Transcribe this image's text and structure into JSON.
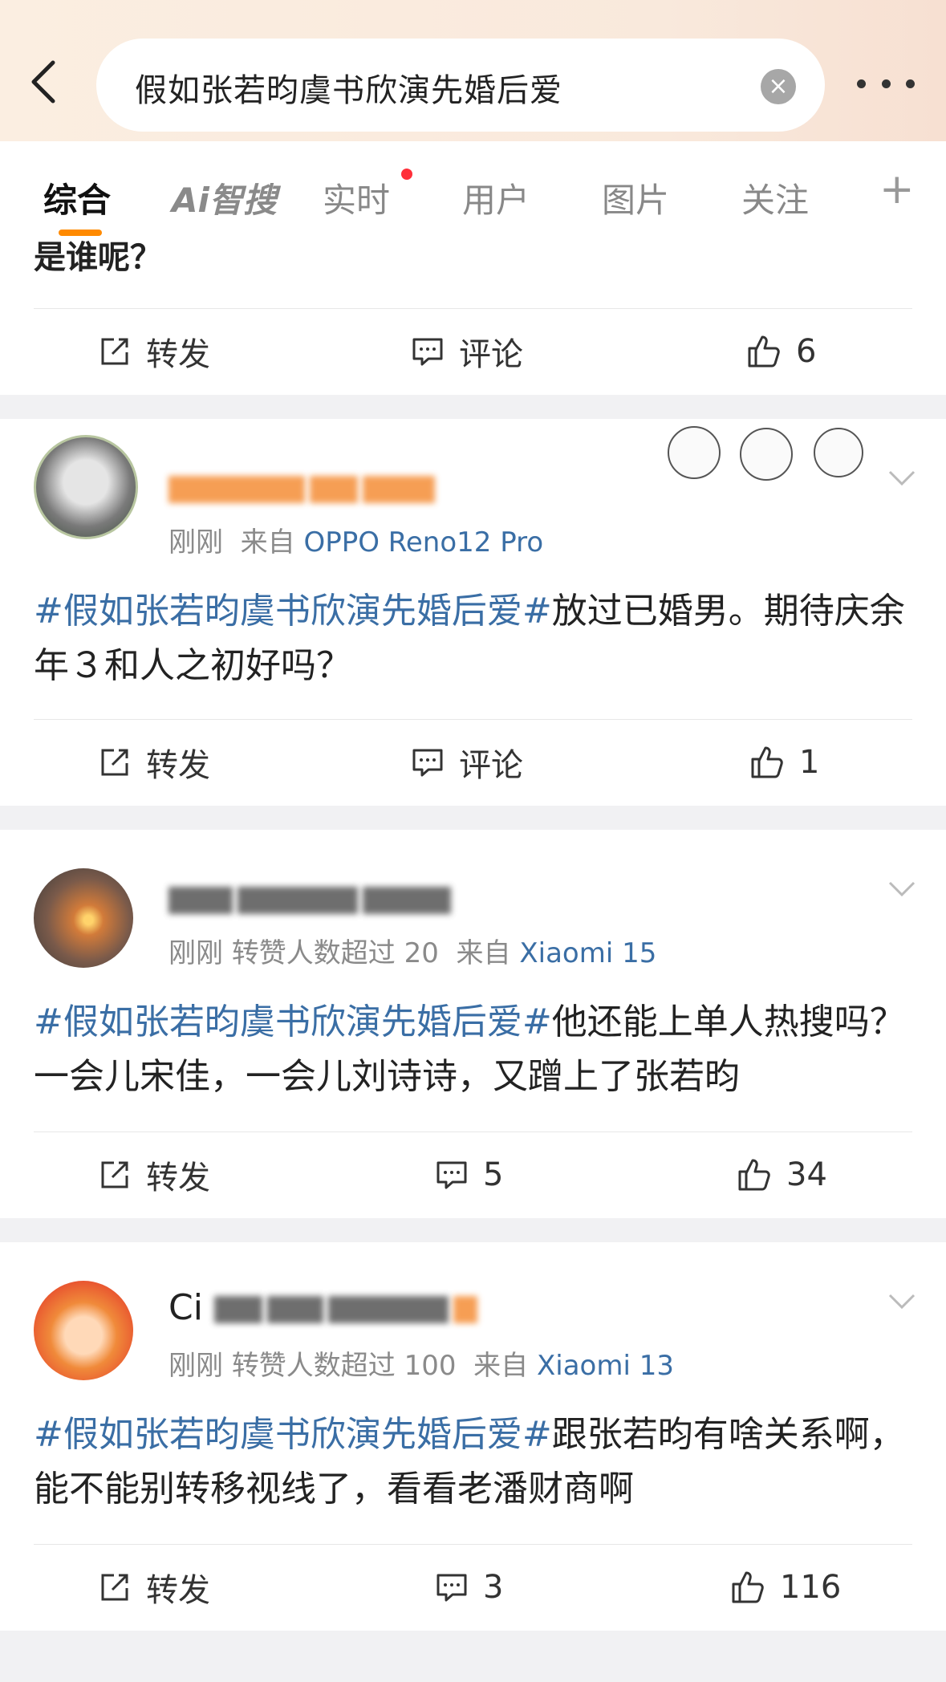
{
  "search": {
    "query": "假如张若昀虞书欣演先婚后爱"
  },
  "tabs": [
    {
      "label": "综合"
    },
    {
      "label": "Ai智搜"
    },
    {
      "label": "实时"
    },
    {
      "label": "用户"
    },
    {
      "label": "图片"
    },
    {
      "label": "关注"
    },
    {
      "label": "+"
    }
  ],
  "colors": {
    "accent": "#ff8a00",
    "link": "#3a6ea5",
    "badge_dot": "#ff2f3a"
  },
  "first_post": {
    "partial_text": "是谁呢？",
    "actions": {
      "repost": "转发",
      "comment": "评论",
      "like": "6"
    }
  },
  "posts": [
    {
      "meta_time": "刚刚",
      "meta_extra": "",
      "meta_from": "来自",
      "meta_source": "OPPO Reno12 Pro",
      "hashtag": "#假如张若昀虞书欣演先婚后爱#",
      "text": "放过已婚男。期待庆余年３和人之初好吗？",
      "actions": {
        "repost": "转发",
        "comment": "评论",
        "like": "1"
      }
    },
    {
      "meta_time": "刚刚",
      "meta_extra": "转赞人数超过 20",
      "meta_from": "来自",
      "meta_source": "Xiaomi 15",
      "hashtag": "#假如张若昀虞书欣演先婚后爱#",
      "text": "他还能上单人热搜吗？一会儿宋佳，一会儿刘诗诗，又蹭上了张若昀",
      "actions": {
        "repost": "转发",
        "comment": "5",
        "like": "34"
      }
    },
    {
      "meta_time": "刚刚",
      "meta_extra": "转赞人数超过 100",
      "meta_from": "来自",
      "meta_source": "Xiaomi 13",
      "hashtag": "#假如张若昀虞书欣演先婚后爱#",
      "text": "跟张若昀有啥关系啊，能不能别转移视线了，看看老潘财商啊",
      "actions": {
        "repost": "转发",
        "comment": "3",
        "like": "116"
      }
    }
  ],
  "post3_name_visible": "Ci",
  "icons": [
    "back-icon",
    "clear-icon",
    "more-icon",
    "repost-icon",
    "comment-icon",
    "like-icon",
    "chevron-down-icon"
  ]
}
